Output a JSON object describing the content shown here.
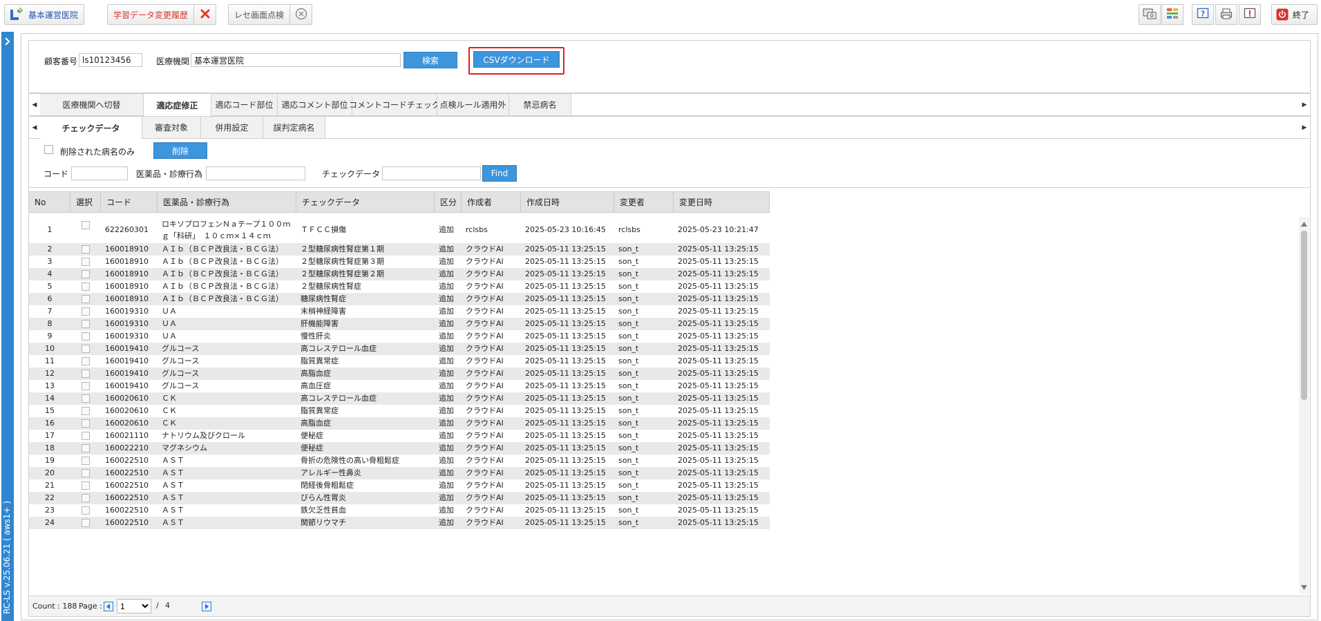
{
  "toolbar": {
    "app_tab_label": "基本運営医院",
    "history_tab_label": "学習データ変更履歴",
    "inspection_tab_label": "レセ画面点検",
    "exit_label": "終了"
  },
  "sidebar": {
    "version": "RC-LS v.25.06.21 ( aws1+ )"
  },
  "search": {
    "customer_no_label": "顧客番号",
    "customer_no_value": "ls10123456",
    "institution_label": "医療機関",
    "institution_value": "基本運営医院",
    "search_button": "検索",
    "csv_button": "CSVダウンロード"
  },
  "tabs_row1": [
    "医療機関へ切替",
    "適応症修正",
    "適応コード部位",
    "適応コメント部位",
    "コメントコードチェック",
    "点検ルール適用外",
    "禁忌病名"
  ],
  "tabs_row2": [
    "チェックデータ",
    "審査対象",
    "併用設定",
    "誤判定病名"
  ],
  "filter": {
    "deleted_only_label": "削除された病名のみ",
    "delete_button": "削除",
    "code_label": "コード",
    "code_value": "",
    "drug_label": "医薬品・診療行為",
    "drug_value": "",
    "check_label": "チェックデータ",
    "check_value": "",
    "find_button": "Find"
  },
  "grid": {
    "columns": [
      "No",
      "選択",
      "コード",
      "医薬品・診療行為",
      "チェックデータ",
      "区分",
      "作成者",
      "作成日時",
      "変更者",
      "変更日時"
    ],
    "first_row": {
      "no": "1",
      "code": "622260301",
      "drug_line1": "ロキソプロフェンＮａテープ１００ｍ",
      "drug_line2": "ｇ「科研」　１０ｃｍ×１４ｃｍ",
      "check": "ＴＦＣＣ損傷",
      "kubun": "追加",
      "creator": "rclsbs",
      "created": "2025-05-23 10:16:45",
      "modifier": "rclsbs",
      "modified": "2025-05-23 10:21:47"
    },
    "rows": [
      [
        "2",
        "160018910",
        "ＡＩｂ（ＢＣＰ改良法・ＢＣＧ法）",
        "２型糖尿病性腎症第１期",
        "追加",
        "クラウドAI",
        "2025-05-11 13:25:15",
        "son_t",
        "2025-05-11 13:25:15"
      ],
      [
        "3",
        "160018910",
        "ＡＩｂ（ＢＣＰ改良法・ＢＣＧ法）",
        "２型糖尿病性腎症第３期",
        "追加",
        "クラウドAI",
        "2025-05-11 13:25:15",
        "son_t",
        "2025-05-11 13:25:15"
      ],
      [
        "4",
        "160018910",
        "ＡＩｂ（ＢＣＰ改良法・ＢＣＧ法）",
        "２型糖尿病性腎症第２期",
        "追加",
        "クラウドAI",
        "2025-05-11 13:25:15",
        "son_t",
        "2025-05-11 13:25:15"
      ],
      [
        "5",
        "160018910",
        "ＡＩｂ（ＢＣＰ改良法・ＢＣＧ法）",
        "２型糖尿病性腎症",
        "追加",
        "クラウドAI",
        "2025-05-11 13:25:15",
        "son_t",
        "2025-05-11 13:25:15"
      ],
      [
        "6",
        "160018910",
        "ＡＩｂ（ＢＣＰ改良法・ＢＣＧ法）",
        "糖尿病性腎症",
        "追加",
        "クラウドAI",
        "2025-05-11 13:25:15",
        "son_t",
        "2025-05-11 13:25:15"
      ],
      [
        "7",
        "160019310",
        "ＵＡ",
        "末梢神経障害",
        "追加",
        "クラウドAI",
        "2025-05-11 13:25:15",
        "son_t",
        "2025-05-11 13:25:15"
      ],
      [
        "8",
        "160019310",
        "ＵＡ",
        "肝機能障害",
        "追加",
        "クラウドAI",
        "2025-05-11 13:25:15",
        "son_t",
        "2025-05-11 13:25:15"
      ],
      [
        "9",
        "160019310",
        "ＵＡ",
        "慢性肝炎",
        "追加",
        "クラウドAI",
        "2025-05-11 13:25:15",
        "son_t",
        "2025-05-11 13:25:15"
      ],
      [
        "10",
        "160019410",
        "グルコース",
        "高コレステロール血症",
        "追加",
        "クラウドAI",
        "2025-05-11 13:25:15",
        "son_t",
        "2025-05-11 13:25:15"
      ],
      [
        "11",
        "160019410",
        "グルコース",
        "脂質異常症",
        "追加",
        "クラウドAI",
        "2025-05-11 13:25:15",
        "son_t",
        "2025-05-11 13:25:15"
      ],
      [
        "12",
        "160019410",
        "グルコース",
        "高脂血症",
        "追加",
        "クラウドAI",
        "2025-05-11 13:25:15",
        "son_t",
        "2025-05-11 13:25:15"
      ],
      [
        "13",
        "160019410",
        "グルコース",
        "高血圧症",
        "追加",
        "クラウドAI",
        "2025-05-11 13:25:15",
        "son_t",
        "2025-05-11 13:25:15"
      ],
      [
        "14",
        "160020610",
        "ＣＫ",
        "高コレステロール血症",
        "追加",
        "クラウドAI",
        "2025-05-11 13:25:15",
        "son_t",
        "2025-05-11 13:25:15"
      ],
      [
        "15",
        "160020610",
        "ＣＫ",
        "脂質異常症",
        "追加",
        "クラウドAI",
        "2025-05-11 13:25:15",
        "son_t",
        "2025-05-11 13:25:15"
      ],
      [
        "16",
        "160020610",
        "ＣＫ",
        "高脂血症",
        "追加",
        "クラウドAI",
        "2025-05-11 13:25:15",
        "son_t",
        "2025-05-11 13:25:15"
      ],
      [
        "17",
        "160021110",
        "ナトリウム及びクロール",
        "便秘症",
        "追加",
        "クラウドAI",
        "2025-05-11 13:25:15",
        "son_t",
        "2025-05-11 13:25:15"
      ],
      [
        "18",
        "160022210",
        "マグネシウム",
        "便秘症",
        "追加",
        "クラウドAI",
        "2025-05-11 13:25:15",
        "son_t",
        "2025-05-11 13:25:15"
      ],
      [
        "19",
        "160022510",
        "ＡＳＴ",
        "骨折の危険性の高い骨粗鬆症",
        "追加",
        "クラウドAI",
        "2025-05-11 13:25:15",
        "son_t",
        "2025-05-11 13:25:15"
      ],
      [
        "20",
        "160022510",
        "ＡＳＴ",
        "アレルギー性鼻炎",
        "追加",
        "クラウドAI",
        "2025-05-11 13:25:15",
        "son_t",
        "2025-05-11 13:25:15"
      ],
      [
        "21",
        "160022510",
        "ＡＳＴ",
        "閉経後骨粗鬆症",
        "追加",
        "クラウドAI",
        "2025-05-11 13:25:15",
        "son_t",
        "2025-05-11 13:25:15"
      ],
      [
        "22",
        "160022510",
        "ＡＳＴ",
        "びらん性胃炎",
        "追加",
        "クラウドAI",
        "2025-05-11 13:25:15",
        "son_t",
        "2025-05-11 13:25:15"
      ],
      [
        "23",
        "160022510",
        "ＡＳＴ",
        "鉄欠乏性貧血",
        "追加",
        "クラウドAI",
        "2025-05-11 13:25:15",
        "son_t",
        "2025-05-11 13:25:15"
      ],
      [
        "24",
        "160022510",
        "ＡＳＴ",
        "関節リウマチ",
        "追加",
        "クラウドAI",
        "2025-05-11 13:25:15",
        "son_t",
        "2025-05-11 13:25:15"
      ]
    ]
  },
  "pager": {
    "count_text": "Count : 188",
    "page_label": "Page :",
    "page_current": "1",
    "page_sep": "/",
    "page_total": "4"
  },
  "colors": {
    "accent": "#3d95dc",
    "sidebar": "#2e86d1",
    "highlight": "#e02020",
    "history_tab_text": "#d9342b"
  }
}
